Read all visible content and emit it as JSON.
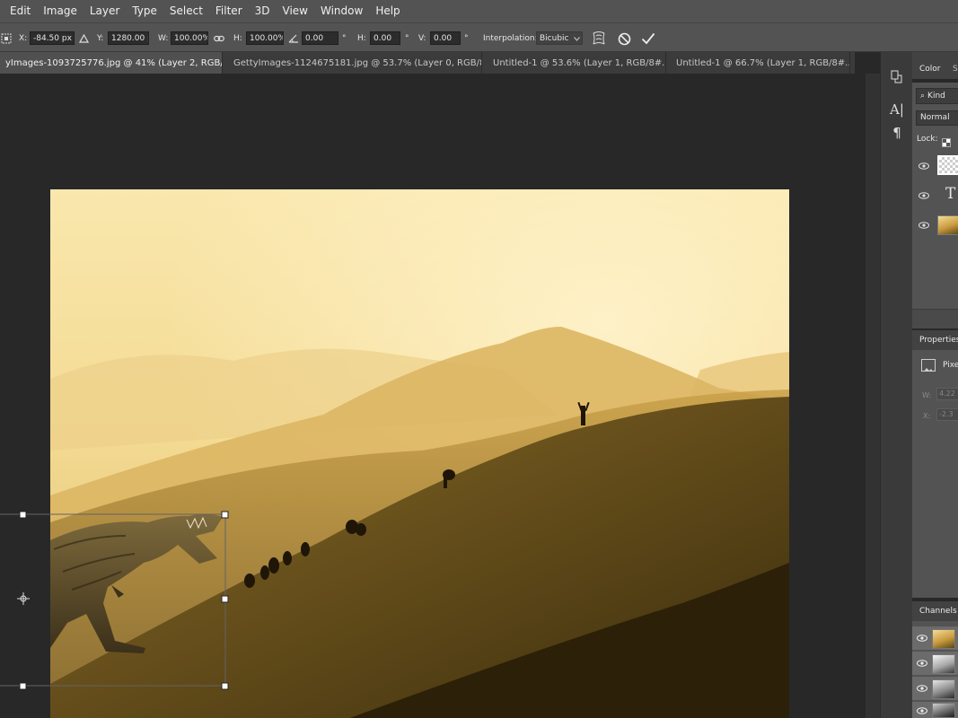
{
  "menu": [
    "Edit",
    "Image",
    "Layer",
    "Type",
    "Select",
    "Filter",
    "3D",
    "View",
    "Window",
    "Help"
  ],
  "options": {
    "x_label": "X:",
    "x_value": "-84.50 px",
    "y_label": "Y:",
    "y_value": "1280.00 p",
    "w_label": "W:",
    "w_value": "100.00%",
    "h_label": "H:",
    "h_value": "100.00%",
    "angle_value": "0.00",
    "degree": "°",
    "hskew_label": "H:",
    "hskew_value": "0.00",
    "vskew_label": "V:",
    "vskew_value": "0.00",
    "interpolation_label": "Interpolation:",
    "interpolation_value": "Bicubic"
  },
  "tabs": [
    {
      "title": "yImages-1093725776.jpg @ 41% (Layer 2, RGB/8) *",
      "close": "×"
    },
    {
      "title": "GettyImages-1124675181.jpg @ 53.7% (Layer 0, RGB/8*...",
      "close": "×"
    },
    {
      "title": "Untitled-1 @ 53.6% (Layer 1, RGB/8#...",
      "close": "×"
    },
    {
      "title": "Untitled-1 @ 66.7% (Layer 1, RGB/8#...",
      "close": "×"
    }
  ],
  "panels": {
    "color_tab": "Color",
    "swatch_tab": "S",
    "layers": {
      "kind_label": "Kind",
      "blend_mode": "Normal",
      "lock_label": "Lock:",
      "text_layer_glyph": "T"
    },
    "properties": {
      "title": "Properties",
      "type_label": "Pixe",
      "w_label": "W:",
      "w_value": "4.22",
      "x_label": "X:",
      "x_value": "-2.3"
    },
    "channels": {
      "title": "Channels"
    }
  },
  "colors": {
    "chrome": "#535353",
    "canvas_bg": "#282828",
    "panel_dark": "#424242",
    "sky": "#f7e2a4",
    "dune": "#5a4516"
  },
  "icons": [
    "move-reference-icon",
    "delta-icon",
    "link-icon",
    "angle-icon",
    "warp-icon",
    "cancel-transform-icon",
    "commit-transform-icon",
    "eye-icon",
    "character-icon",
    "paragraph-icon",
    "history-icon"
  ]
}
